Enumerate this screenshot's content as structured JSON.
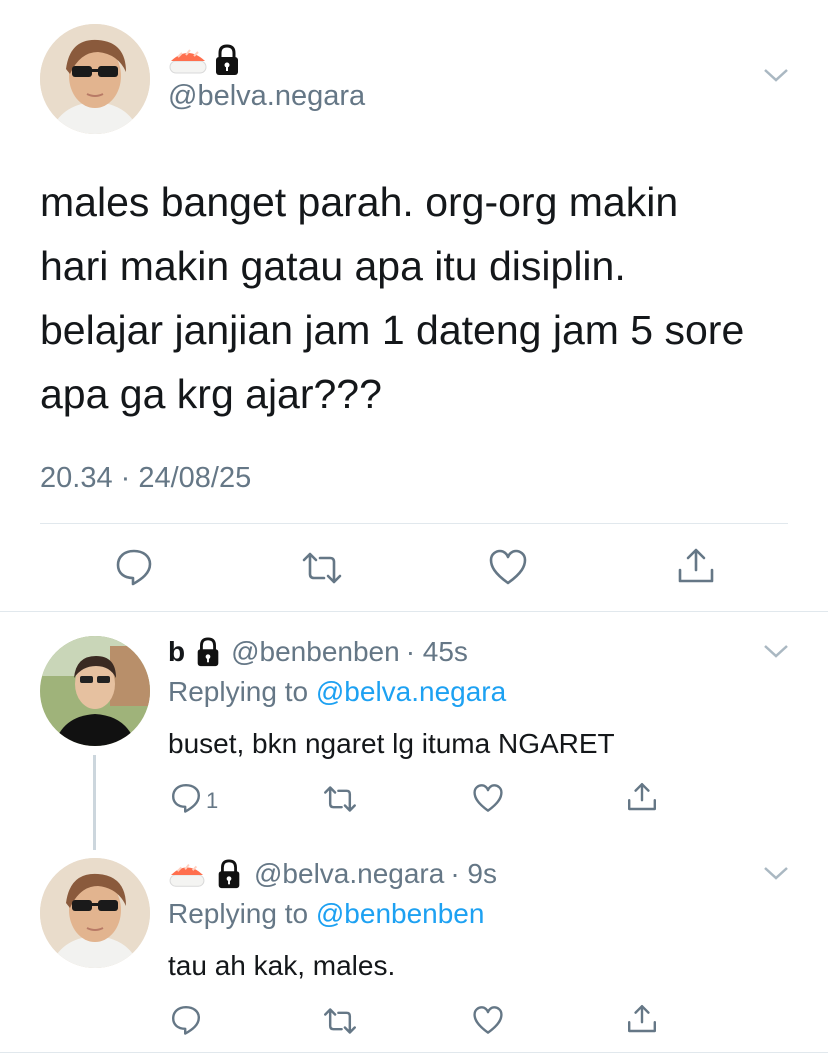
{
  "main_tweet": {
    "handle": "@belva.negara",
    "text_lines": [
      "males banget parah. org-org makin",
      "hari makin gatau apa itu disiplin.",
      "belajar janjian jam 1 dateng jam 5 sore",
      "apa ga krg ajar???"
    ],
    "timestamp": "20.34 · 24/08/25",
    "emoji": "🍣",
    "actions": [
      "reply-icon",
      "retweet-icon",
      "like-icon",
      "share-icon"
    ]
  },
  "replies": [
    {
      "display_name": "b",
      "handle": "@benbenben",
      "time": "· 45s",
      "replying_prefix": "Replying to",
      "replying_to": "@belva.negara",
      "text": "buset, bkn ngaret lg ituma NGARET",
      "reply_count": "1"
    },
    {
      "display_name": "🍣",
      "handle": "@belva.negara",
      "time": "· 9s",
      "replying_prefix": "Replying to",
      "replying_to": "@benbenben",
      "text": "tau ah kak, males.",
      "reply_count": ""
    }
  ],
  "colors": {
    "text": "#14171a",
    "muted": "#657786",
    "link": "#1da1f2",
    "divider": "#e1e8ed"
  }
}
